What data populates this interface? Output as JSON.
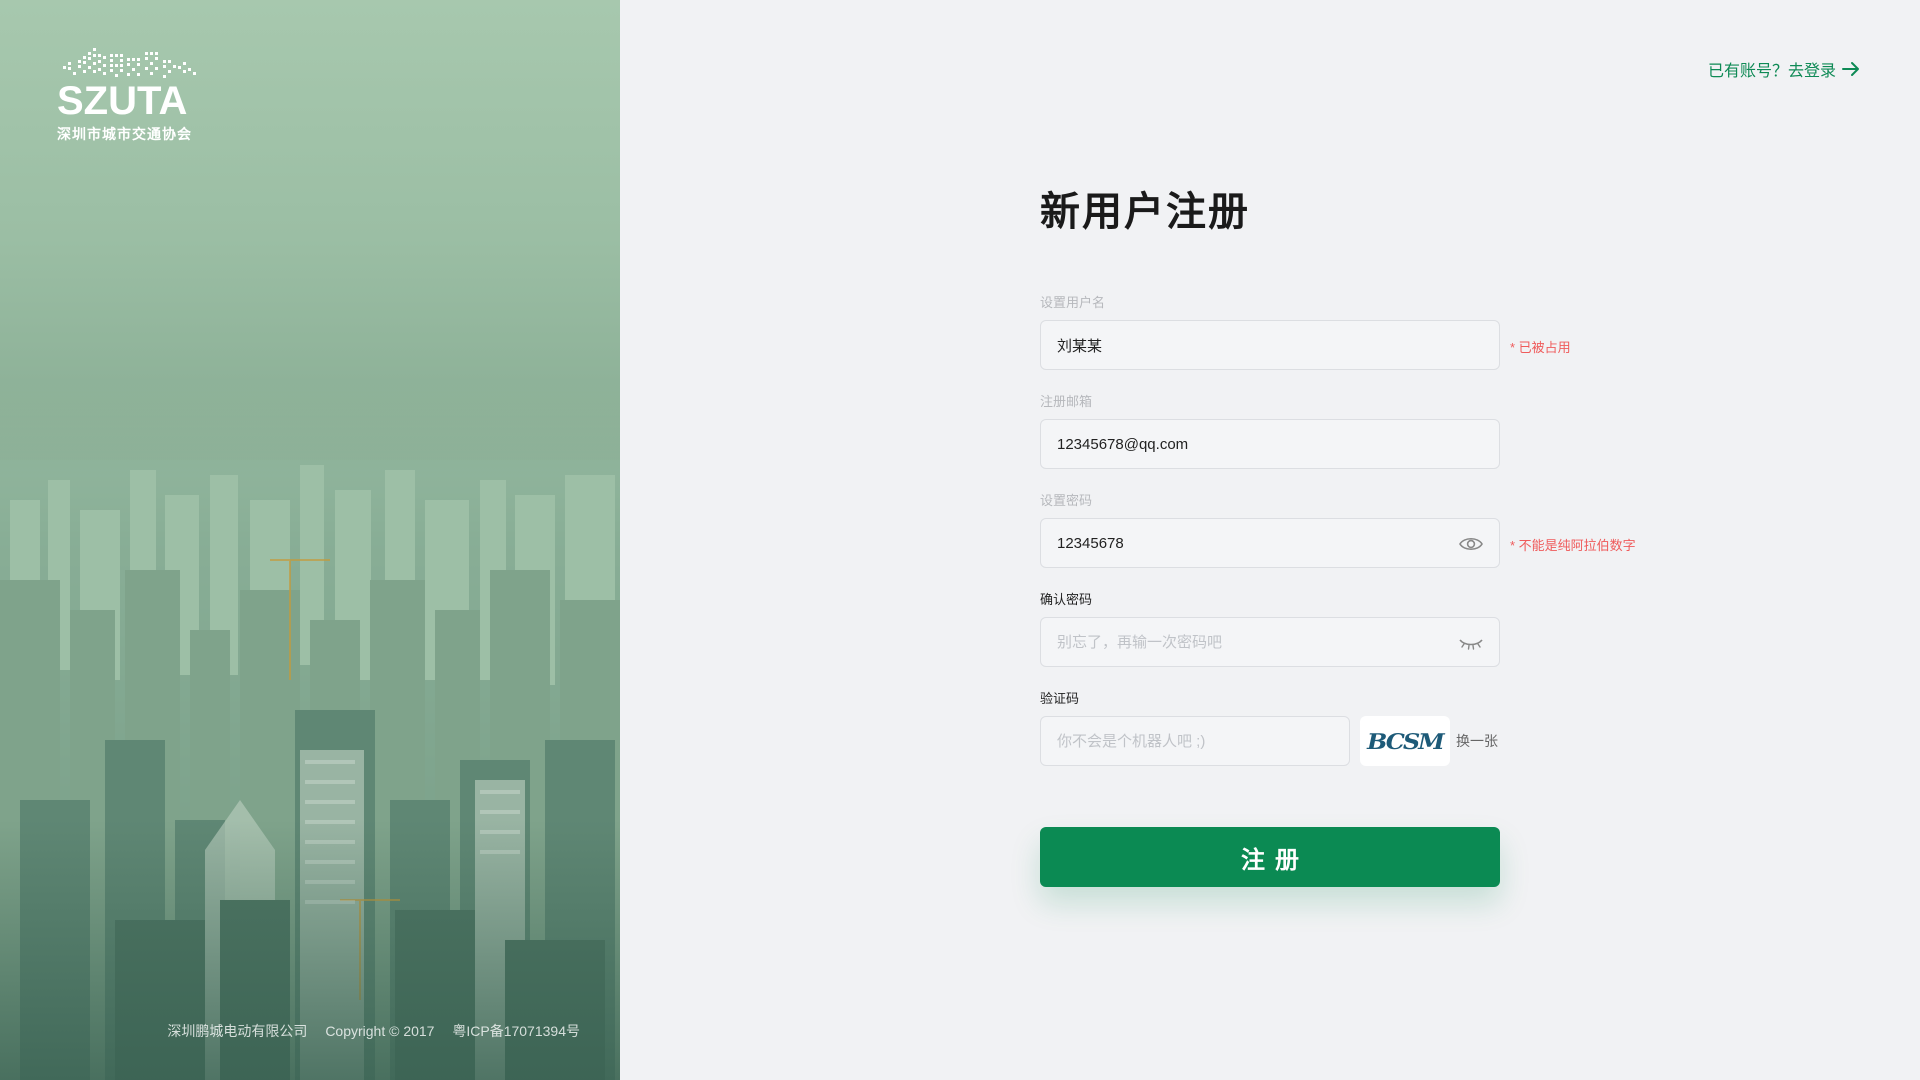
{
  "brand": {
    "logo_text": "SZUTA",
    "subtitle": "深圳市城市交通协会"
  },
  "footer": {
    "company": "深圳鹏城电动有限公司",
    "copyright": "Copyright © 2017",
    "icp": "粤ICP备17071394号"
  },
  "header": {
    "login_link": "已有账号？去登录"
  },
  "form": {
    "title": "新用户注册",
    "username": {
      "label": "设置用户名",
      "value": "刘某某",
      "placeholder": "",
      "error": "* 已被占用"
    },
    "email": {
      "label": "注册邮箱",
      "value": "12345678@qq.com",
      "placeholder": ""
    },
    "password": {
      "label": "设置密码",
      "value": "12345678",
      "placeholder": "",
      "error": "* 不能是纯阿拉伯数字",
      "icon": "eye-open-icon"
    },
    "confirm_password": {
      "label": "确认密码",
      "value": "",
      "placeholder": "别忘了，再输一次密码吧",
      "icon": "eye-closed-icon"
    },
    "captcha": {
      "label": "验证码",
      "value": "",
      "placeholder": "你不会是个机器人吧 ;)",
      "image_text": "BCSM",
      "refresh_label": "换一张"
    },
    "submit_label": "注册"
  },
  "colors": {
    "accent": "#0b8a53",
    "error": "#ef5b5b",
    "background": "#f1f2f4"
  }
}
